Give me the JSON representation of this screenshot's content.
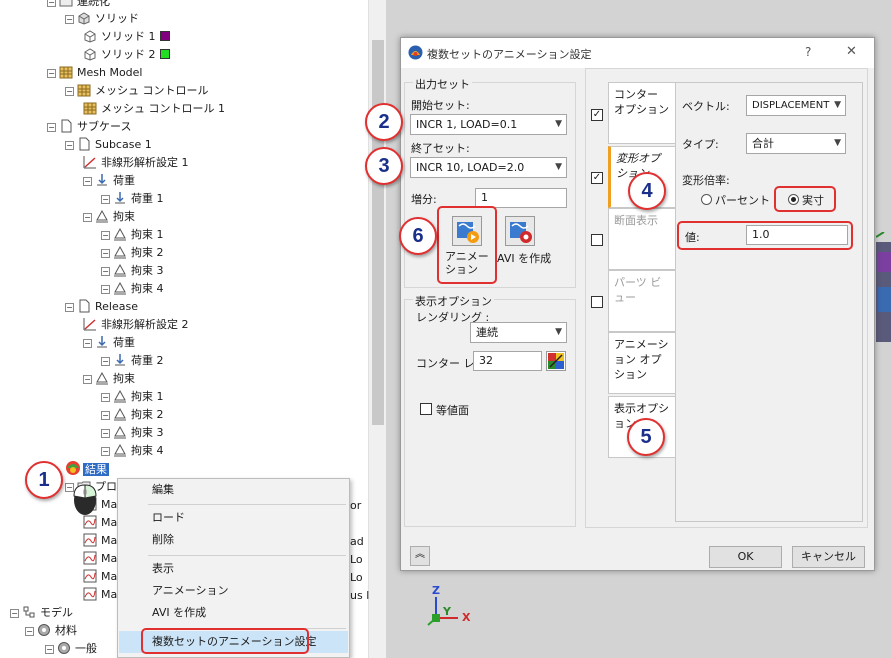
{
  "tree": {
    "rows": [
      {
        "label": "連続化",
        "indent": 3
      },
      {
        "label": "ソリッド",
        "indent": 4
      },
      {
        "label": "ソリッド 1",
        "indent": 5
      },
      {
        "label": "ソリッド 2",
        "indent": 5
      },
      {
        "label": "Mesh Model",
        "indent": 3
      },
      {
        "label": "メッシュ コントロール",
        "indent": 4
      },
      {
        "label": "メッシュ コントロール 1",
        "indent": 5
      },
      {
        "label": "サブケース",
        "indent": 3
      },
      {
        "label": "Subcase 1",
        "indent": 4
      },
      {
        "label": "非線形解析設定 1",
        "indent": 5
      },
      {
        "label": "荷重",
        "indent": 5
      },
      {
        "label": "荷重 1",
        "indent": 6
      },
      {
        "label": "拘束",
        "indent": 5
      },
      {
        "label": "拘束 1",
        "indent": 6
      },
      {
        "label": "拘束 2",
        "indent": 6
      },
      {
        "label": "拘束 3",
        "indent": 6
      },
      {
        "label": "拘束 4",
        "indent": 6
      },
      {
        "label": "Release",
        "indent": 4
      },
      {
        "label": "非線形解析設定 2",
        "indent": 5
      },
      {
        "label": "荷重",
        "indent": 5
      },
      {
        "label": "荷重 2",
        "indent": 6
      },
      {
        "label": "拘束",
        "indent": 5
      },
      {
        "label": "拘束 1",
        "indent": 6
      },
      {
        "label": "拘束 2",
        "indent": 6
      },
      {
        "label": "拘束 3",
        "indent": 6
      },
      {
        "label": "拘束 4",
        "indent": 6
      },
      {
        "label": "結果",
        "indent": 4
      },
      {
        "label": "プロ",
        "indent": 4
      },
      {
        "label": "Ma",
        "indent": 5
      },
      {
        "label": "Ma",
        "indent": 5
      },
      {
        "label": "Ma",
        "indent": 5
      },
      {
        "label": "Ma",
        "indent": 5
      },
      {
        "label": "Ma",
        "indent": 5
      },
      {
        "label": "Ma",
        "indent": 5
      },
      {
        "label": "モデル",
        "indent": 0
      },
      {
        "label": "材料",
        "indent": 1
      },
      {
        "label": "一般",
        "indent": 2
      }
    ],
    "right_fragments": [
      "or",
      "ad",
      "Lo",
      "Lo",
      "us l"
    ]
  },
  "context_menu": {
    "items": [
      "編集",
      "ロード",
      "削除",
      "表示",
      "アニメーション",
      "AVI を作成",
      "複数セットのアニメーション設定"
    ]
  },
  "dialog": {
    "title": "複数セットのアニメーション設定",
    "help": "?",
    "close": "✕",
    "output_set": {
      "group_label": "出力セット",
      "start_label": "開始セット:",
      "start_value": "INCR 1, LOAD=0.1",
      "end_label": "終了セット:",
      "end_value": "INCR 10, LOAD=2.0",
      "increment_label": "増分:",
      "increment_value": "1",
      "animation_label": "アニメーション",
      "avi_label": "AVI を作成"
    },
    "display_options": {
      "group_label": "表示オプション",
      "rendering_label": "レンダリング :",
      "rendering_value": "連続",
      "contour_label": "コンター レ",
      "contour_value": "32",
      "isovalue_label": "等値面"
    },
    "tabs": [
      {
        "label": "コンター オプション",
        "checked": true
      },
      {
        "label": "変形オプション",
        "checked": true
      },
      {
        "label": "断面表示",
        "checked": false
      },
      {
        "label": "パーツ ビュー",
        "checked": false
      },
      {
        "label": "アニメーション オプション"
      },
      {
        "label": "表示オプション"
      }
    ],
    "deform": {
      "vector_label": "ベクトル:",
      "vector_value": "DISPLACEMENT",
      "type_label": "タイプ:",
      "type_value": "合計",
      "scale_label": "変形倍率:",
      "percent_label": "パーセント",
      "actual_label": "実寸",
      "value_label": "値:",
      "value": "1.0"
    },
    "ok": "OK",
    "cancel": "キャンセル"
  },
  "callouts": [
    "1",
    "2",
    "3",
    "4",
    "5",
    "6"
  ],
  "axes": {
    "z": "Z",
    "y": "Y",
    "x": "X"
  }
}
